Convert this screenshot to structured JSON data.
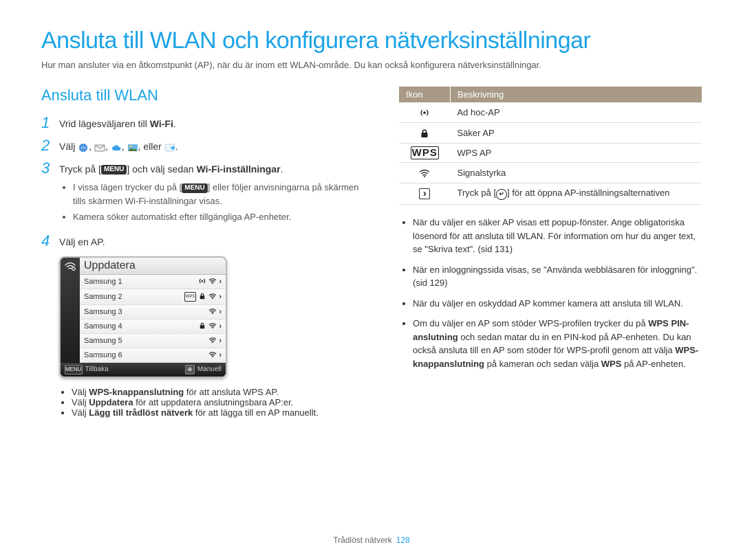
{
  "title": "Ansluta till WLAN och konfigurera nätverksinställningar",
  "intro": "Hur man ansluter via en åtkomstpunkt (AP), när du är inom ett WLAN-område. Du kan också konfigurera nätverksinställningar.",
  "section_heading": "Ansluta till WLAN",
  "steps": {
    "s1": {
      "pre": "Vrid lägesväljaren till ",
      "bold": "Wi-Fi",
      "post": "."
    },
    "s2": {
      "pre": "Välj ",
      "sep": ", ",
      "or": ", eller ",
      "post": "."
    },
    "s3": {
      "pre": "Tryck på [",
      "menu": "MENU",
      "mid": "] och välj sedan ",
      "bold": "Wi-Fi-inställningar",
      "post": ".",
      "bullets": [
        "I vissa lägen trycker du på [MENU] eller följer anvisningarna på skärmen tills skärmen Wi-Fi-inställningar visas.",
        "Kamera söker automatiskt efter tillgängliga AP-enheter."
      ]
    },
    "s4": {
      "text": "Välj en AP."
    }
  },
  "ap_widget": {
    "refresh": "Uppdatera",
    "rows": [
      {
        "name": "Samsung 1",
        "adhoc": true,
        "wps": false,
        "lock": false,
        "wifi": true
      },
      {
        "name": "Samsung 2",
        "adhoc": false,
        "wps": true,
        "lock": true,
        "wifi": true
      },
      {
        "name": "Samsung 3",
        "adhoc": false,
        "wps": false,
        "lock": false,
        "wifi": true
      },
      {
        "name": "Samsung 4",
        "adhoc": false,
        "wps": false,
        "lock": true,
        "wifi": true
      },
      {
        "name": "Samsung 5",
        "adhoc": false,
        "wps": false,
        "lock": false,
        "wifi": true
      },
      {
        "name": "Samsung 6",
        "adhoc": false,
        "wps": false,
        "lock": false,
        "wifi": true
      }
    ],
    "back": "Tillbaka",
    "manual": "Manuell",
    "back_icon": "MENU"
  },
  "left_bullets": [
    {
      "pre": "Välj ",
      "bold": "WPS-knappanslutning",
      "post": " för att ansluta WPS AP."
    },
    {
      "pre": "Välj ",
      "bold": "Uppdatera",
      "post": " för att uppdatera anslutningsbara AP:er."
    },
    {
      "pre": "Välj ",
      "bold": "Lägg till trådlöst nätverk",
      "post": " för att lägga till en AP manuellt."
    }
  ],
  "icon_table": {
    "headers": {
      "icon": "Ikon",
      "desc": "Beskrivning"
    },
    "rows": [
      {
        "icon": "adhoc",
        "desc": "Ad hoc-AP"
      },
      {
        "icon": "lock",
        "desc": "Säker AP"
      },
      {
        "icon": "wps",
        "desc": "WPS AP"
      },
      {
        "icon": "wifi",
        "desc": "Signalstyrka"
      },
      {
        "icon": "arrow",
        "desc_pre": "Tryck på [",
        "desc_mid": "] för att öppna AP-inställningsalternativen"
      }
    ]
  },
  "right_bullets": [
    "När du väljer en säker AP visas ett popup-fönster. Ange obligatoriska lösenord för att ansluta till WLAN. För information om hur du anger text, se \"Skriva text\". (sid 131)",
    "När en inloggningssida visas, se \"Använda webbläsaren för inloggning\". (sid 129)",
    "När du väljer en oskyddad AP kommer kamera att ansluta till WLAN."
  ],
  "right_bullet4": {
    "parts": [
      "Om du väljer en AP som stöder WPS-profilen trycker du på ",
      "WPS PIN-anslutning",
      " och sedan matar du in en PIN-kod på AP-enheten. Du kan också ansluta till en AP som stöder för WPS-profil genom att välja ",
      "WPS-knappanslutning",
      " på kameran och sedan välja ",
      "WPS",
      " på AP-enheten."
    ]
  },
  "footer": {
    "label": "Trådlöst nätverk",
    "page": "128"
  }
}
